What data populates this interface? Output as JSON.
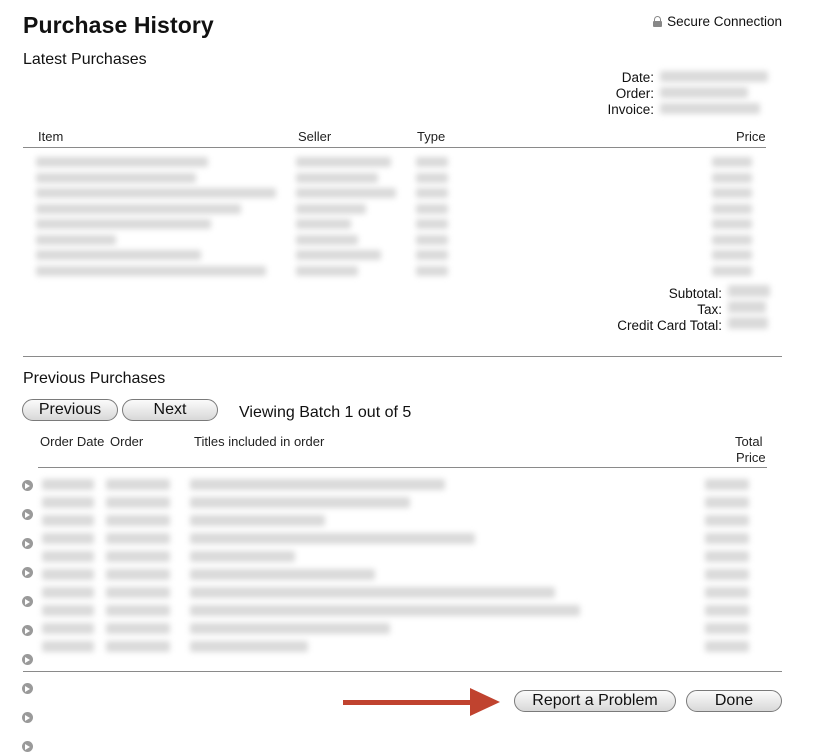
{
  "header": {
    "title": "Purchase History",
    "secure_label": "Secure Connection",
    "lock_icon": "lock-icon"
  },
  "latest": {
    "section_title": "Latest Purchases",
    "meta_labels": {
      "date": "Date:",
      "order": "Order:",
      "invoice": "Invoice:"
    },
    "columns": {
      "item": "Item",
      "seller": "Seller",
      "type": "Type",
      "price": "Price"
    },
    "row_count": 8,
    "totals": {
      "subtotal": "Subtotal:",
      "tax": "Tax:",
      "cc_total": "Credit Card Total:"
    }
  },
  "previous": {
    "section_title": "Previous Purchases",
    "previous_button": "Previous",
    "next_button": "Next",
    "viewing": "Viewing Batch 1 out of 5",
    "columns": {
      "order_date": "Order Date",
      "order": "Order",
      "titles": "Titles included in order",
      "total_price_line1": "Total",
      "total_price_line2": "Price"
    },
    "row_count": 10
  },
  "footer": {
    "report_button": "Report a Problem",
    "done_button": "Done"
  },
  "colors": {
    "annotation_arrow": "#c0432f",
    "divider": "#8a8a8a"
  }
}
